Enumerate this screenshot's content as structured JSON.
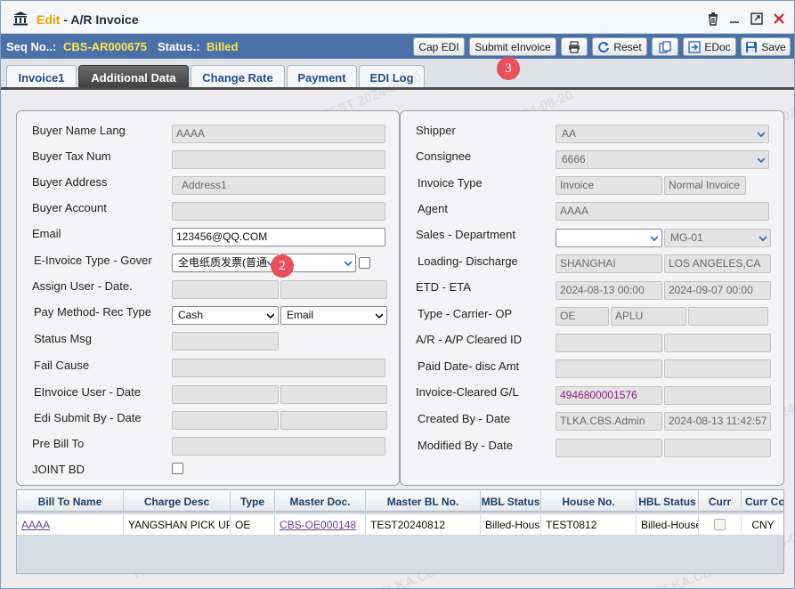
{
  "window": {
    "mode": "Edit",
    "separator": " - ",
    "title": "A/R Invoice"
  },
  "info": {
    "seq_label": "Seq No..:",
    "seq_value": "CBS-AR000675",
    "status_label": "Status.:",
    "status_value": "Billed"
  },
  "toolbar": {
    "cap_edi": "Cap EDI",
    "submit_einvoice": "Submit eInvoice",
    "reset": "Reset",
    "edoc": "EDoc",
    "save": "Save"
  },
  "badges": {
    "step2": "2",
    "step3": "3"
  },
  "tabs": [
    {
      "label": "Invoice1",
      "active": false
    },
    {
      "label": "Additional Data",
      "active": true
    },
    {
      "label": "Change Rate",
      "active": false
    },
    {
      "label": "Payment",
      "active": false
    },
    {
      "label": "EDI Log",
      "active": false
    }
  ],
  "left": {
    "buyer_name_lang": {
      "label": "Buyer Name Lang",
      "value": "AAAA"
    },
    "buyer_tax_num": {
      "label": "Buyer Tax Num",
      "value": ""
    },
    "buyer_address": {
      "label": "Buyer Address",
      "value": "Address1"
    },
    "buyer_account": {
      "label": "Buyer Account",
      "value": ""
    },
    "email": {
      "label": "Email",
      "value": "123456@QQ.COM"
    },
    "einvoice_type": {
      "label": "E-Invoice Type -  Gover",
      "value": "全电纸质发票(普通",
      "gov_value": ""
    },
    "assign_user": {
      "label": "Assign User - Date.",
      "user": "",
      "date": ""
    },
    "pay_method": {
      "label": "Pay Method-  Rec Type",
      "method": "Cash",
      "rec_type": "Email"
    },
    "status_msg": {
      "label": "Status Msg",
      "value": ""
    },
    "fail_cause": {
      "label": "Fail Cause",
      "value": ""
    },
    "einvoice_user": {
      "label": "EInvoice User -  Date",
      "user": "",
      "date": ""
    },
    "edi_submit_by": {
      "label": "Edi Submit By -  Date",
      "user": "",
      "date": ""
    },
    "pre_bill_to": {
      "label": "Pre Bill To",
      "value": ""
    },
    "joint_bd": {
      "label": "JOINT BD"
    }
  },
  "right": {
    "shipper": {
      "label": "Shipper",
      "value": "AA"
    },
    "consignee": {
      "label": "Consignee",
      "value": "6666"
    },
    "invoice_type": {
      "label": "Invoice Type",
      "value": "Invoice",
      "value2": "Normal Invoice"
    },
    "agent": {
      "label": "Agent",
      "value": "AAAA"
    },
    "sales_department": {
      "label": "Sales - Department",
      "sales": "",
      "department": "MG-01"
    },
    "loading_discharge": {
      "label": "Loading- Discharge",
      "loading": "SHANGHAI",
      "discharge": "LOS ANGELES,CA"
    },
    "etd_eta": {
      "label": "ETD - ETA",
      "etd": "2024-08-13 00:00",
      "eta": "2024-09-07 00:00"
    },
    "type_carrier_op": {
      "label": "Type -  Carrier-  OP",
      "type": "OE",
      "carrier": "APLU",
      "op": ""
    },
    "ar_ap_cleared": {
      "label": "A/R - A/P Cleared ID",
      "ar": "",
      "ap": ""
    },
    "paid_date": {
      "label": "Paid Date- disc Amt",
      "date": "",
      "amt": ""
    },
    "invoice_cleared_gl": {
      "label": "Invoice-Cleared G/L",
      "invoice": "4946800001576",
      "gl": ""
    },
    "created_by": {
      "label": "Created By -  Date",
      "user": "TLKA.CBS.Admin",
      "date": "2024-08-13 11:42:57"
    },
    "modified_by": {
      "label": "Modified By -  Date",
      "user": "",
      "date": ""
    }
  },
  "grid": {
    "columns": [
      "Bill To Name",
      "Charge Desc",
      "Type",
      "Master Doc.",
      "Master BL No.",
      "MBL Status",
      "House No.",
      "HBL Status",
      "Curr",
      "Curr Cod"
    ],
    "rows": [
      [
        "AAAA",
        "YANGSHAN PICK UP",
        "OE",
        "CBS-OE000148",
        "TEST20240812",
        "Billed-House",
        "TEST0812",
        "Billed-House",
        "",
        "CNY"
      ]
    ]
  },
  "watermark": "TLKA.CBS.TEST 2024-08-20",
  "colors": {
    "accent_bar": "#4a72a8",
    "highlight_text": "#ffe44d",
    "edit_mode": "#f0a000",
    "badge": "#e8505b"
  }
}
